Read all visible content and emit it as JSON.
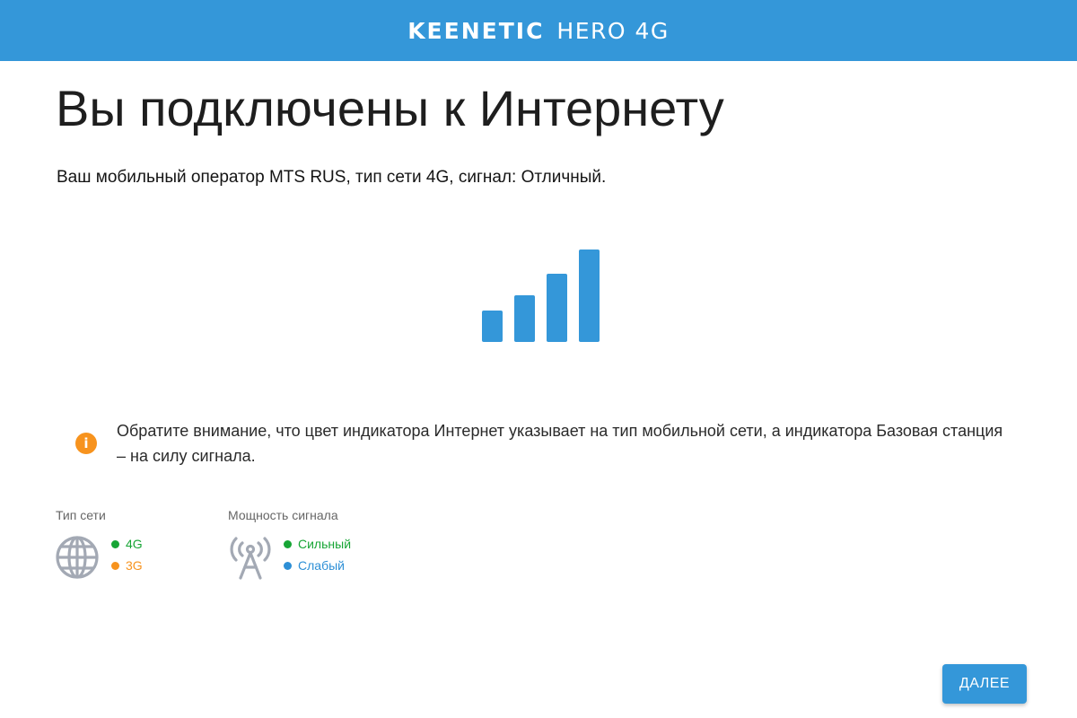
{
  "header": {
    "brand": "KEENETIC",
    "model": "HERO 4G"
  },
  "page": {
    "title": "Вы подключены к Интернету",
    "subtitle": "Ваш мобильный оператор MTS RUS, тип сети 4G, сигнал: Отличный."
  },
  "signal_indicator": {
    "bars_active": 4,
    "bars_total": 4,
    "icon": "signal-bars-icon",
    "color": "#3497d9"
  },
  "notice": {
    "icon": "info-icon",
    "icon_color": "#f7931e",
    "text": "Обратите внимание, что цвет индикатора Интернет указывает на тип мобильной сети, а индикатора Базовая станция – на силу сигнала."
  },
  "legend": {
    "network_type": {
      "title": "Тип сети",
      "icon": "globe-icon",
      "items": [
        {
          "label": "4G",
          "color": "#17a535"
        },
        {
          "label": "3G",
          "color": "#f7931e"
        }
      ]
    },
    "signal_strength": {
      "title": "Мощность сигнала",
      "icon": "antenna-tower-icon",
      "items": [
        {
          "label": "Сильный",
          "color": "#17a535"
        },
        {
          "label": "Слабый",
          "color": "#2d8fd6"
        }
      ]
    }
  },
  "actions": {
    "next_label": "ДАЛЕЕ"
  }
}
